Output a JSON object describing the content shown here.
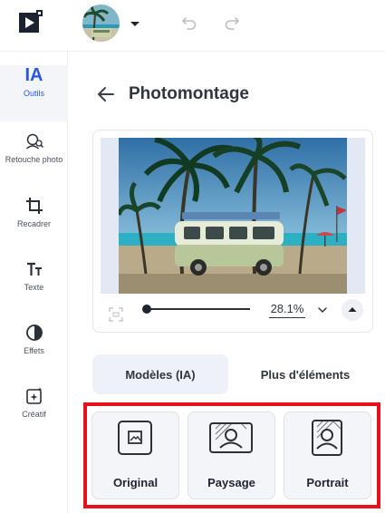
{
  "sidebar": {
    "items": [
      {
        "label": "Outils",
        "icon": "ia-icon",
        "glyph": "IA"
      },
      {
        "label": "Retouche photo",
        "icon": "retouch-icon"
      },
      {
        "label": "Recadrer",
        "icon": "crop-icon"
      },
      {
        "label": "Texte",
        "icon": "text-icon"
      },
      {
        "label": "Effets",
        "icon": "effects-icon"
      },
      {
        "label": "Créatif",
        "icon": "creative-icon"
      }
    ]
  },
  "panel": {
    "title": "Photomontage"
  },
  "preview": {
    "zoom": "28.1%"
  },
  "tabs": [
    {
      "label": "Modèles (IA)",
      "active": true
    },
    {
      "label": "Plus d'éléments",
      "active": false
    }
  ],
  "options": [
    {
      "label": "Original",
      "icon": "image-icon"
    },
    {
      "label": "Paysage",
      "icon": "landscape-portrait-icon"
    },
    {
      "label": "Portrait",
      "icon": "portrait-icon"
    }
  ],
  "colors": {
    "accent": "#2a55e5",
    "highlight": "#e8111b"
  }
}
